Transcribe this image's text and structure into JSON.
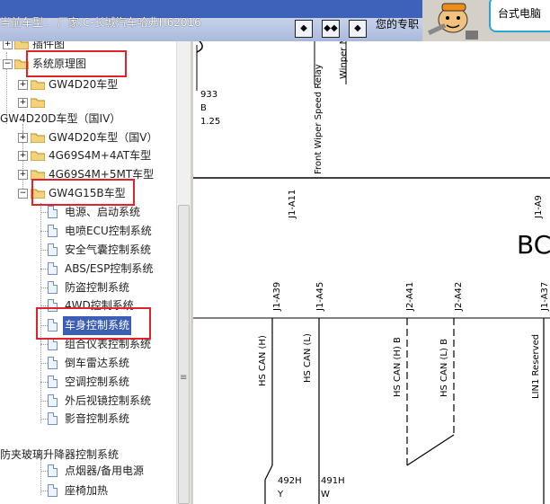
{
  "topbar": {
    "current_model": "当前车型：  厂家:C-长城汽车哈弗H62016",
    "nav_buttons": [
      "◆",
      "◆◆",
      "◆"
    ],
    "message": "您的专职",
    "callout_text": "台式电脑"
  },
  "tree": {
    "items": [
      {
        "label": "插件图",
        "level": 0
      },
      {
        "label": "系统原理图",
        "level": 0
      },
      {
        "label": "GW4D20车型",
        "level": 1
      },
      {
        "label": "",
        "level": 1
      },
      {
        "label": "GW4D20D车型（国IV）",
        "level": 0
      },
      {
        "label": "GW4D20车型（国Ⅴ）",
        "level": 1
      },
      {
        "label": "4G69S4M+4AT车型",
        "level": 1
      },
      {
        "label": "4G69S4M+5MT车型",
        "level": 1
      },
      {
        "label": "GW4G15B车型",
        "level": 1
      },
      {
        "label": "电源、启动系统",
        "level": 2
      },
      {
        "label": "电喷ECU控制系统",
        "level": 2
      },
      {
        "label": "安全气囊控制系统",
        "level": 2
      },
      {
        "label": "ABS/ESP控制系统",
        "level": 2
      },
      {
        "label": "防盗控制系统",
        "level": 2
      },
      {
        "label": "4WD控制系统",
        "level": 2
      },
      {
        "label": "车身控制系统",
        "level": 2,
        "selected": true
      },
      {
        "label": "组合仪表控制系统",
        "level": 2
      },
      {
        "label": "倒车雷达系统",
        "level": 2
      },
      {
        "label": "空调控制系统",
        "level": 2
      },
      {
        "label": "外后视镜控制系统",
        "level": 2
      },
      {
        "label": "影音控制系统",
        "level": 2
      },
      {
        "label": "防夹玻璃升降器控制系统",
        "level": 0
      },
      {
        "label": "点烟器/备用电源",
        "level": 2
      },
      {
        "label": "座椅加热",
        "level": 2
      }
    ],
    "scroll_grip": "≡"
  },
  "diagram": {
    "top_labels": [
      "Front Wiper Speed Relay",
      "Winper M"
    ],
    "wire_info": [
      "933",
      "B",
      "1.25"
    ],
    "pins_upper": [
      "J1-A11",
      "J1-A9"
    ],
    "module_label": "BC",
    "pins_lower": [
      "J1-A39",
      "J1-A45",
      "J2-A41",
      "J2-A42",
      "J1-A37"
    ],
    "signals": [
      "HS CAN (H)",
      "HS CAN (L)",
      "HS CAN (H) B",
      "HS CAN (L) B",
      "LIN1 Reserved"
    ],
    "wire_ids": [
      {
        "id": "492H",
        "color": "Y"
      },
      {
        "id": "491H",
        "color": "W"
      }
    ]
  }
}
